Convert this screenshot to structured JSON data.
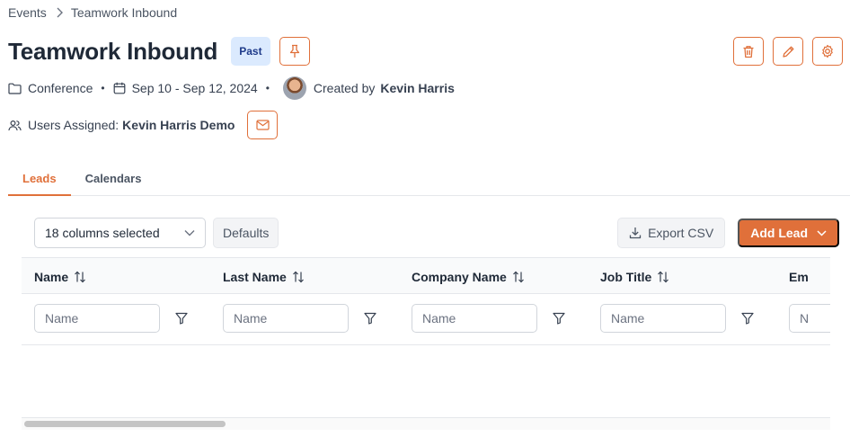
{
  "breadcrumb": {
    "parent": "Events",
    "current": "Teamwork Inbound"
  },
  "header": {
    "title": "Teamwork Inbound",
    "status_badge": "Past"
  },
  "meta": {
    "event_type": "Conference",
    "date_range": "Sep 10 - Sep 12, 2024",
    "created_by_label": "Created by",
    "created_by_name": "Kevin Harris"
  },
  "users": {
    "label": "Users Assigned:",
    "names": "Kevin Harris Demo"
  },
  "tabs": [
    {
      "label": "Leads",
      "active": true
    },
    {
      "label": "Calendars",
      "active": false
    }
  ],
  "toolbar": {
    "columns_selected": "18 columns selected",
    "defaults_label": "Defaults",
    "export_label": "Export CSV",
    "add_label": "Add Lead"
  },
  "table": {
    "columns": [
      "Name",
      "Last Name",
      "Company Name",
      "Job Title",
      "Em"
    ],
    "filter_placeholders": [
      "Name",
      "Name",
      "Name",
      "Name",
      "N"
    ]
  },
  "colors": {
    "accent": "#e0703a",
    "badge_bg": "#dbeafe",
    "badge_text": "#1e3a8a"
  }
}
